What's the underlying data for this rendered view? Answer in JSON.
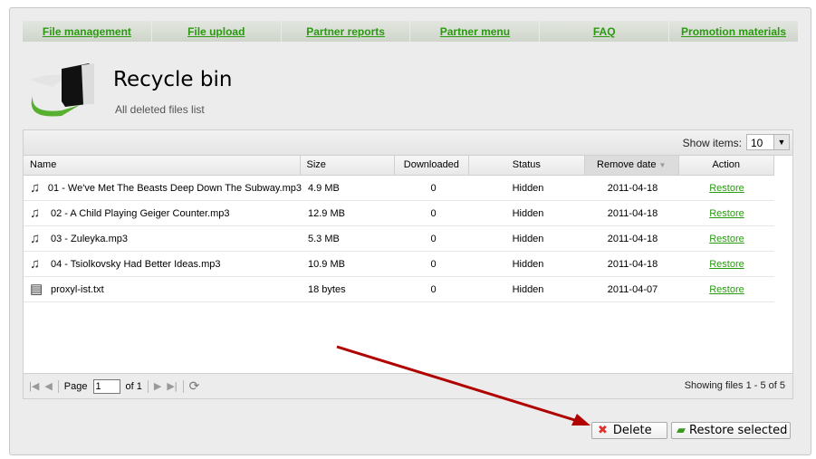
{
  "nav": [
    "File management",
    "File upload",
    "Partner reports",
    "Partner menu",
    "FAQ",
    "Promotion materials"
  ],
  "header": {
    "title": "Recycle bin",
    "subtitle": "All deleted files list"
  },
  "grid": {
    "show_items_label": "Show items:",
    "show_items_value": "10",
    "columns": [
      "Name",
      "Size",
      "Downloaded",
      "Status",
      "Remove date",
      "Action"
    ],
    "sorted_column": "Remove date",
    "rows": [
      {
        "icon": "music-icon",
        "name": "01 - We've Met The Beasts Deep Down The Subway.mp3",
        "size": "4.9 MB",
        "downloaded": "0",
        "status": "Hidden",
        "date": "2011-04-18",
        "action": "Restore"
      },
      {
        "icon": "music-icon",
        "name": "02 - A Child Playing Geiger Counter.mp3",
        "size": "12.9 MB",
        "downloaded": "0",
        "status": "Hidden",
        "date": "2011-04-18",
        "action": "Restore"
      },
      {
        "icon": "music-icon",
        "name": "03 - Zuleyka.mp3",
        "size": "5.3 MB",
        "downloaded": "0",
        "status": "Hidden",
        "date": "2011-04-18",
        "action": "Restore"
      },
      {
        "icon": "music-icon",
        "name": "04 - Tsiolkovsky Had Better Ideas.mp3",
        "size": "10.9 MB",
        "downloaded": "0",
        "status": "Hidden",
        "date": "2011-04-18",
        "action": "Restore"
      },
      {
        "icon": "text-file-icon",
        "name": "proxyl-ist.txt",
        "size": "18 bytes",
        "downloaded": "0",
        "status": "Hidden",
        "date": "2011-04-07",
        "action": "Restore"
      }
    ],
    "pager": {
      "page_label": "Page",
      "page": "1",
      "of_label": "of 1",
      "info": "Showing files 1 - 5 of 5"
    }
  },
  "buttons": {
    "delete": "Delete",
    "restore_selected": "Restore selected"
  },
  "colors": {
    "link": "#2a9a10",
    "arrow": "#b00000"
  }
}
